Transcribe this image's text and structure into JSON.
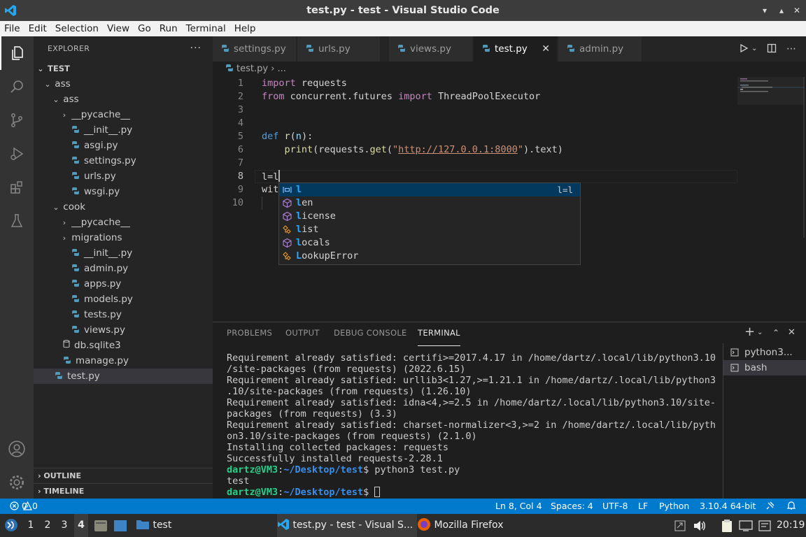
{
  "window": {
    "title": "test.py - test - Visual Studio Code"
  },
  "menu": [
    "File",
    "Edit",
    "Selection",
    "View",
    "Go",
    "Run",
    "Terminal",
    "Help"
  ],
  "explorer": {
    "header": "EXPLORER",
    "more": "···",
    "root": "TEST",
    "items": [
      {
        "label": "ass",
        "kind": "folder",
        "open": true
      },
      {
        "label": "ass",
        "kind": "folder",
        "open": true
      },
      {
        "label": "__pycache__",
        "kind": "folder",
        "open": false
      },
      {
        "label": "__init__.py",
        "kind": "py"
      },
      {
        "label": "asgi.py",
        "kind": "py"
      },
      {
        "label": "settings.py",
        "kind": "py"
      },
      {
        "label": "urls.py",
        "kind": "py"
      },
      {
        "label": "wsgi.py",
        "kind": "py"
      },
      {
        "label": "cook",
        "kind": "folder",
        "open": true
      },
      {
        "label": "__pycache__",
        "kind": "folder",
        "open": false
      },
      {
        "label": "migrations",
        "kind": "folder",
        "open": false
      },
      {
        "label": "__init__.py",
        "kind": "py"
      },
      {
        "label": "admin.py",
        "kind": "py"
      },
      {
        "label": "apps.py",
        "kind": "py"
      },
      {
        "label": "models.py",
        "kind": "py"
      },
      {
        "label": "tests.py",
        "kind": "py"
      },
      {
        "label": "views.py",
        "kind": "py"
      },
      {
        "label": "db.sqlite3",
        "kind": "db"
      },
      {
        "label": "manage.py",
        "kind": "py"
      },
      {
        "label": "test.py",
        "kind": "py",
        "selected": true
      }
    ],
    "outline": "OUTLINE",
    "timeline": "TIMELINE"
  },
  "tabs": [
    {
      "label": "settings.py"
    },
    {
      "label": "urls.py"
    },
    {
      "label": "views.py"
    },
    {
      "label": "test.py",
      "active": true,
      "close": "✕"
    },
    {
      "label": "admin.py"
    }
  ],
  "breadcrumb": {
    "file": "test.py",
    "sep": "›",
    "rest": "..."
  },
  "editor": {
    "line_numbers": [
      "1",
      "2",
      "3",
      "4",
      "5",
      "6",
      "7",
      "8",
      "9",
      "10"
    ],
    "current_line": "8",
    "lines": {
      "l1_kw": "import",
      "l1_rest": " requests",
      "l2_kw": "from",
      "l2_mod": " concurrent.futures ",
      "l2_kw2": "import",
      "l2_cls": " ThreadPoolExecutor",
      "l5_def": "def",
      "l5_fn": " r",
      "l5_p1": "(",
      "l5_arg": "n",
      "l5_p2": "):",
      "l6_indent": "    ",
      "l6_print": "print",
      "l6_a": "(",
      "l6_mod": "requests",
      "l6_dot": ".",
      "l6_get": "get",
      "l6_b": "(",
      "l6_q1": "\"",
      "l6_url": "http://127.0.0.1:8000",
      "l6_q2": "\"",
      "l6_c": ").",
      "l6_text": "text",
      "l6_d": ")",
      "l8": "l=l",
      "l9": "wit"
    }
  },
  "suggest": {
    "items": [
      {
        "match": "l",
        "rest": "",
        "icon": "variable-icon",
        "detail": "l=l",
        "selected": true
      },
      {
        "match": "l",
        "rest": "en",
        "icon": "method-icon"
      },
      {
        "match": "l",
        "rest": "icense",
        "icon": "method-icon"
      },
      {
        "match": "l",
        "rest": "ist",
        "icon": "class-icon"
      },
      {
        "match": "l",
        "rest": "ocals",
        "icon": "method-icon"
      },
      {
        "match": "L",
        "rest": "ookupError",
        "icon": "class-icon"
      }
    ]
  },
  "panel": {
    "tabs": [
      "PROBLEMS",
      "OUTPUT",
      "DEBUG CONSOLE",
      "TERMINAL"
    ],
    "active_tab": "TERMINAL",
    "terminal_lines": [
      "Requirement already satisfied: certifi>=2017.4.17 in /home/dartz/.local/lib/python3.10",
      "/site-packages (from requests) (2022.6.15)",
      "Requirement already satisfied: urllib3<1.27,>=1.21.1 in /home/dartz/.local/lib/python3",
      ".10/site-packages (from requests) (1.26.10)",
      "Requirement already satisfied: idna<4,>=2.5 in /home/dartz/.local/lib/python3.10/site-",
      "packages (from requests) (3.3)",
      "Requirement already satisfied: charset-normalizer<3,>=2 in /home/dartz/.local/lib/pyth",
      "on3.10/site-packages (from requests) (2.1.0)",
      "Installing collected packages: requests",
      "Successfully installed requests-2.28.1"
    ],
    "prompt_user": "dartz@VM3",
    "prompt_colon": ":",
    "prompt_path": "~/Desktop/test",
    "prompt_dollar": "$",
    "command": " python3 test.py",
    "output": "test",
    "terminals": [
      {
        "label": "python3...",
        "selected": false
      },
      {
        "label": "bash",
        "selected": true
      }
    ]
  },
  "statusbar": {
    "errors": "0",
    "warnings": "0",
    "position": "Ln 8, Col 4",
    "spaces": "Spaces: 4",
    "encoding": "UTF-8",
    "eol": "LF",
    "language": "Python",
    "interpreter": "3.10.4 64-bit"
  },
  "taskbar": {
    "workspaces": [
      "1",
      "2",
      "3",
      "4"
    ],
    "active_workspace": "4",
    "folder": "test",
    "vscode_task": "test.py - test - Visual S...",
    "firefox_task": "Mozilla Firefox",
    "clock": "20:19"
  },
  "colors": {
    "accent": "#007acc",
    "selection": "#04395e",
    "python_icon": "#519aba"
  }
}
